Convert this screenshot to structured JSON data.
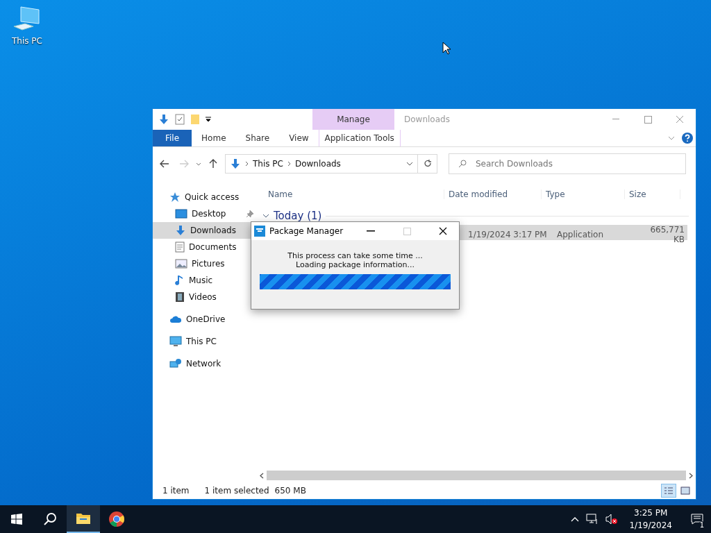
{
  "desktop_icons": [
    {
      "label": "This PC"
    }
  ],
  "explorer": {
    "title": "Downloads",
    "context_group": "Manage",
    "ribbon_tabs": [
      {
        "label": "File",
        "kind": "file",
        "selected": false
      },
      {
        "label": "Home",
        "kind": "tab",
        "selected": false
      },
      {
        "label": "Share",
        "kind": "tab",
        "selected": false
      },
      {
        "label": "View",
        "kind": "tab",
        "selected": false
      },
      {
        "label": "Application Tools",
        "kind": "context",
        "selected": false
      }
    ],
    "path": [
      "This PC",
      "Downloads"
    ],
    "search": {
      "placeholder": "Search Downloads"
    },
    "nav": [
      {
        "label": "Quick access",
        "selected": false,
        "children": [
          {
            "label": "Desktop",
            "selected": false,
            "pinned": true
          },
          {
            "label": "Downloads",
            "selected": true,
            "pinned": false
          },
          {
            "label": "Documents",
            "selected": false,
            "pinned": false
          },
          {
            "label": "Pictures",
            "selected": false,
            "pinned": false
          },
          {
            "label": "Music",
            "selected": false,
            "pinned": false
          },
          {
            "label": "Videos",
            "selected": false,
            "pinned": false
          }
        ]
      },
      {
        "label": "OneDrive",
        "selected": false
      },
      {
        "label": "This PC",
        "selected": false
      },
      {
        "label": "Network",
        "selected": false
      }
    ],
    "columns": [
      "Name",
      "Date modified",
      "Type",
      "Size"
    ],
    "groups": [
      {
        "label": "Today (1)",
        "expanded": true,
        "rows": [
          {
            "date": "1/19/2024 3:17 PM",
            "type": "Application",
            "size": "665,771 KB",
            "selected": true
          }
        ]
      }
    ],
    "status": {
      "count": "1 item",
      "selection": "1 item selected",
      "size": "650 MB"
    }
  },
  "dialog": {
    "title": "Package Manager",
    "lines": [
      "This process can take some time ...",
      "Loading package information..."
    ],
    "progress": {
      "level": 1
    }
  },
  "taskbar": {
    "time": "3:25 PM",
    "date": "1/19/2024",
    "notifications": "1"
  }
}
